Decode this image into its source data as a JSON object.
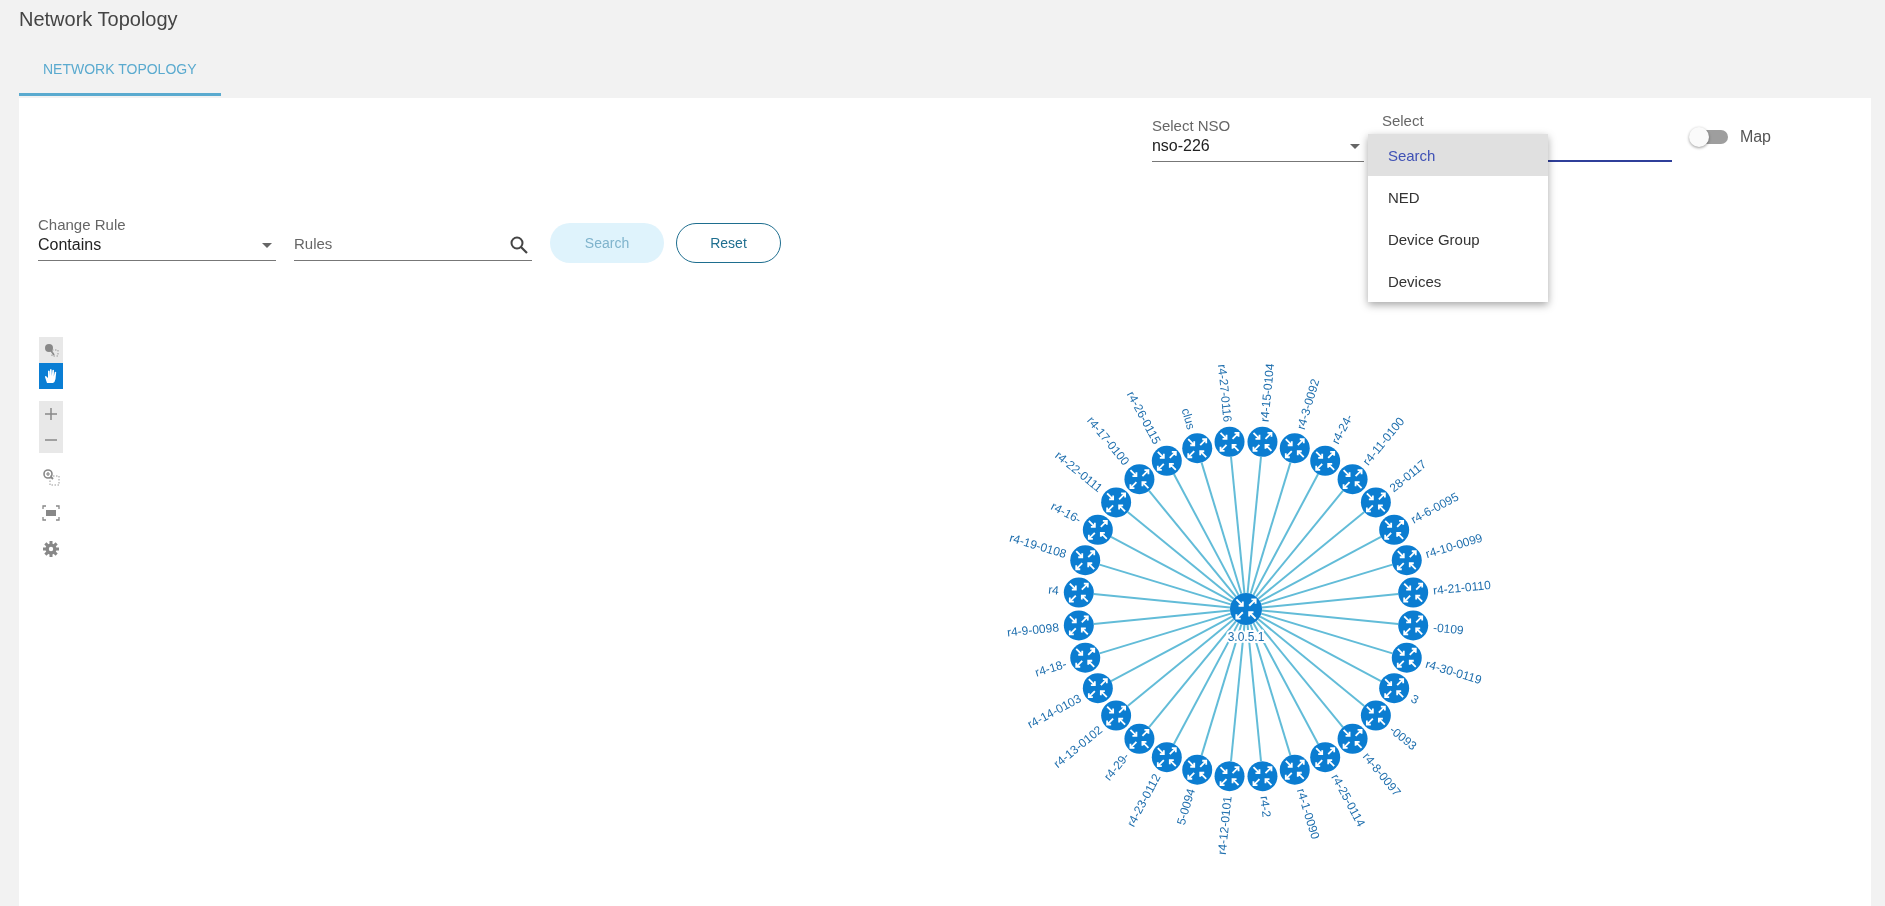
{
  "page": {
    "title": "Network Topology"
  },
  "tabs": [
    {
      "label": "NETWORK TOPOLOGY",
      "selected": true
    }
  ],
  "nso": {
    "label": "Select NSO",
    "value": "nso-226"
  },
  "select": {
    "label": "Select",
    "focused": true
  },
  "dropdown": {
    "items": [
      {
        "label": "Search",
        "selected": true
      },
      {
        "label": "NED",
        "selected": false
      },
      {
        "label": "Device Group",
        "selected": false
      },
      {
        "label": "Devices",
        "selected": false
      }
    ]
  },
  "map_toggle": {
    "label": "Map",
    "on": false
  },
  "rule": {
    "label": "Change Rule",
    "value": "Contains"
  },
  "rules": {
    "placeholder": "Rules"
  },
  "buttons": [
    {
      "label": "Search",
      "kind": "primary",
      "disabled": true
    },
    {
      "label": "Reset",
      "kind": "outline",
      "disabled": false
    }
  ],
  "toolbar": [
    {
      "kind": "select",
      "selected": false
    },
    {
      "kind": "pan",
      "selected": true
    },
    {
      "kind": "zoom-in",
      "selected": false
    },
    {
      "kind": "zoom-out",
      "selected": false
    },
    {
      "kind": "zoom-area",
      "selected": false
    },
    {
      "kind": "fit",
      "selected": false
    },
    {
      "kind": "settings",
      "selected": false
    }
  ],
  "topology": {
    "center": {
      "label": "3.0.5.1"
    },
    "nodes": [
      {
        "label": "r4-15-0104"
      },
      {
        "label": "r4-3-0092"
      },
      {
        "label": "r4-24-"
      },
      {
        "label": "r4-11-0100"
      },
      {
        "label": "28-0117"
      },
      {
        "label": "r4-6-0095"
      },
      {
        "label": "r4-10-0099"
      },
      {
        "label": "r4-21-0110"
      },
      {
        "label": "-0109"
      },
      {
        "label": "r4-30-0119"
      },
      {
        "label": "3"
      },
      {
        "label": "-0093"
      },
      {
        "label": "r4-8-0097"
      },
      {
        "label": "r4-25-0114"
      },
      {
        "label": "r4-1-0090"
      },
      {
        "label": "r4-2"
      },
      {
        "label": "r4-12-0101"
      },
      {
        "label": "5-0094"
      },
      {
        "label": "r4-23-0112"
      },
      {
        "label": "r4-29-"
      },
      {
        "label": "r4-13-0102"
      },
      {
        "label": "r4-14-0103"
      },
      {
        "label": "r4-18-"
      },
      {
        "label": "r4-9-0098"
      },
      {
        "label": "r4"
      },
      {
        "label": "r4-19-0108"
      },
      {
        "label": "r4-16-"
      },
      {
        "label": "r4-22-0111"
      },
      {
        "label": "r4-17-0100"
      },
      {
        "label": "r4-26-0115"
      },
      {
        "label": "clus"
      },
      {
        "label": "r4-27-0116"
      }
    ]
  }
}
